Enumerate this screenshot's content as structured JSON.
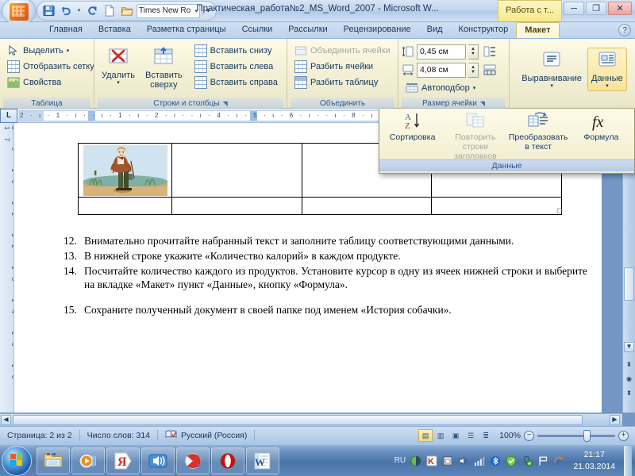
{
  "titlebar": {
    "document_title": "Практическая_работа№2_MS_Word_2007 - Microsoft W...",
    "context_tab_title": "Работа с т...",
    "quick_access": {
      "save_icon": "save-icon",
      "undo_icon": "undo-icon",
      "redo_icon": "redo-icon",
      "new_icon": "new-document-icon",
      "open_icon": "open-folder-icon",
      "font_name": "Times New Ro",
      "more_label": "▾"
    },
    "window_buttons": {
      "minimize": "─",
      "restore": "❐",
      "close": "✕"
    }
  },
  "tabs": [
    {
      "label": "Главная",
      "active": false
    },
    {
      "label": "Вставка",
      "active": false
    },
    {
      "label": "Разметка страницы",
      "active": false
    },
    {
      "label": "Ссылки",
      "active": false
    },
    {
      "label": "Рассылки",
      "active": false
    },
    {
      "label": "Рецензирование",
      "active": false
    },
    {
      "label": "Вид",
      "active": false
    },
    {
      "label": "Конструктор",
      "active": false
    },
    {
      "label": "Макет",
      "active": true
    }
  ],
  "help_button": "?",
  "ribbon": {
    "groups": [
      {
        "label": "Таблица",
        "items": [
          {
            "label": "Выделить",
            "caret": "▾",
            "icon": "select-arrow-icon",
            "disabled": false
          },
          {
            "label": "Отобразить сетку",
            "caret": "",
            "icon": "view-gridlines-icon",
            "disabled": false
          },
          {
            "label": "Свойства",
            "caret": "",
            "icon": "table-properties-icon",
            "disabled": false
          }
        ]
      },
      {
        "label": "Строки и столбцы",
        "has_launcher": true,
        "big_buttons": [
          {
            "label": "Удалить",
            "caret": "▾",
            "icon": "delete-table-icon"
          },
          {
            "label": "Вставить\nсверху",
            "caret": "",
            "icon": "insert-above-icon"
          }
        ],
        "items": [
          {
            "label": "Вставить снизу",
            "icon": "insert-below-icon",
            "disabled": false
          },
          {
            "label": "Вставить слева",
            "icon": "insert-left-icon",
            "disabled": false
          },
          {
            "label": "Вставить справа",
            "icon": "insert-right-icon",
            "disabled": false
          }
        ]
      },
      {
        "label": "Объединить",
        "items": [
          {
            "label": "Объединить ячейки",
            "icon": "merge-cells-icon",
            "disabled": true
          },
          {
            "label": "Разбить ячейки",
            "icon": "split-cells-icon",
            "disabled": false
          },
          {
            "label": "Разбить таблицу",
            "icon": "split-table-icon",
            "disabled": false
          }
        ]
      },
      {
        "label": "Размер ячейки",
        "has_launcher": true,
        "height_value": "0,45 см",
        "width_value": "4,08 см",
        "autofit_label": "Автоподбор",
        "autofit_caret": "▾",
        "height_icon": "row-height-icon",
        "width_icon": "column-width-icon",
        "distribute_rows_icon": "distribute-rows-icon",
        "distribute_cols_icon": "distribute-columns-icon",
        "autofit_icon": "autofit-icon"
      },
      {
        "label": "",
        "big_buttons": [
          {
            "label": "Выравнивание",
            "caret": "▾",
            "icon": "alignment-icon",
            "active": false
          },
          {
            "label": "Данные",
            "caret": "▾",
            "icon": "data-icon",
            "active": true
          }
        ]
      }
    ]
  },
  "data_dropdown": {
    "group_label": "Данные",
    "items": [
      {
        "label": "Сортировка",
        "icon": "sort-az-icon",
        "disabled": false
      },
      {
        "label": "Повторить строки заголовков",
        "icon": "repeat-header-rows-icon",
        "disabled": true
      },
      {
        "label": "Преобразовать в текст",
        "icon": "convert-to-text-icon",
        "disabled": false
      },
      {
        "label": "Формула",
        "icon": "formula-fx-icon",
        "disabled": false
      }
    ]
  },
  "ruler": {
    "tab_selector": "L",
    "horizontal_marks": "2 · ı · 1 · ı ·  · ı · 1 · ı · 2 · ı ·  · ı · 4 · ı · 5 · ı · 6 · ı ·  · ı · 8 · ı · 9 · ı ·",
    "vertical_marks": "8 9 10 11 12 13 14 15 16 17"
  },
  "document": {
    "table": {
      "rows": 2,
      "columns": 4,
      "image_alt": "illustration-man-with-cane"
    },
    "paragraphs": [
      {
        "num": "12.",
        "text": "Внимательно прочитайте набранный текст и заполните таблицу соответствующими данными.",
        "gap": false
      },
      {
        "num": "13.",
        "text": "В нижней строке укажите «Количество калорий» в каждом продукте.",
        "gap": false
      },
      {
        "num": "14.",
        "text": "Посчитайте количество каждого из продуктов. Установите курсор в одну из ячеек нижней строки и выберите на вкладке «Макет» пункт «Данные», кнопку «Формула».",
        "gap": false
      },
      {
        "num": "15.",
        "text": "Сохраните полученный документ в своей папке под именем «История собачки».",
        "gap": true
      }
    ]
  },
  "statusbar": {
    "page": "Страница: 2 из 2",
    "words": "Число слов: 314",
    "proofing_icon": "spellcheck-icon",
    "language": "Русский (Россия)",
    "views": [
      {
        "name": "print-layout-view",
        "glyph": "▤",
        "active": true
      },
      {
        "name": "full-screen-reading-view",
        "glyph": "▥",
        "active": false
      },
      {
        "name": "web-layout-view",
        "glyph": "▣",
        "active": false
      },
      {
        "name": "outline-view",
        "glyph": "☰",
        "active": false
      },
      {
        "name": "draft-view",
        "glyph": "≣",
        "active": false
      }
    ],
    "zoom": "100%",
    "zoom_out": "−",
    "zoom_in": "+"
  },
  "taskbar": {
    "start_label": "start-orb",
    "buttons": [
      {
        "name": "explorer",
        "icon": "folder-icon"
      },
      {
        "name": "media-player",
        "icon": "media-player-icon"
      },
      {
        "name": "yandex",
        "icon": "yandex-ya-icon"
      },
      {
        "name": "volume-app",
        "icon": "speaker-icon"
      },
      {
        "name": "yandex-browser",
        "icon": "yandex-browser-icon"
      },
      {
        "name": "opera",
        "icon": "opera-icon"
      },
      {
        "name": "word",
        "icon": "word-icon"
      }
    ],
    "tray": {
      "language": "RU",
      "icons": [
        "gadget-icon",
        "kaspersky-icon",
        "device-icon",
        "volume-icon",
        "network-signal-icon",
        "bluetooth-icon",
        "shield-ok-icon",
        "usb-ok-icon",
        "flag-icon",
        "update-icon"
      ],
      "time": "21:17",
      "date": "21.03.2014"
    }
  }
}
